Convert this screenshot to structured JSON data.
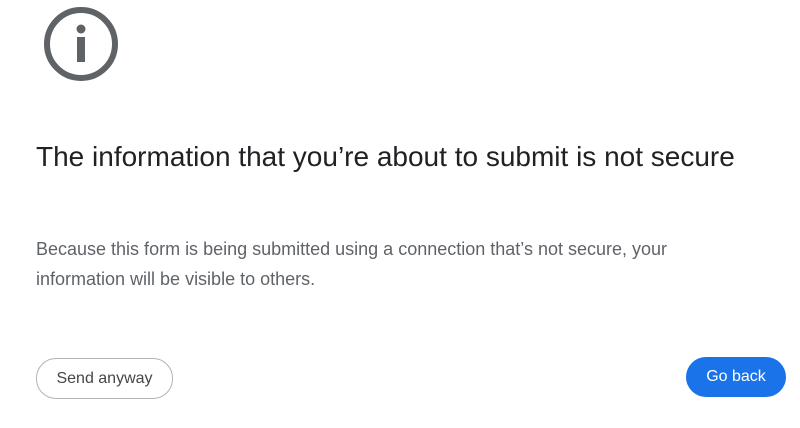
{
  "interstitial": {
    "icon": "info-icon",
    "title": "The information that you’re about to submit is not secure",
    "description": "Because this form is being submitted using a connection that’s not secure, your information will be visible to others.",
    "secondary_button": "Send anyway",
    "primary_button": "Go back"
  },
  "colors": {
    "primary_accent": "#1a73e8",
    "icon": "#5f6368",
    "title_text": "#202124",
    "body_text": "#5f6368",
    "background": "#ffffff"
  }
}
